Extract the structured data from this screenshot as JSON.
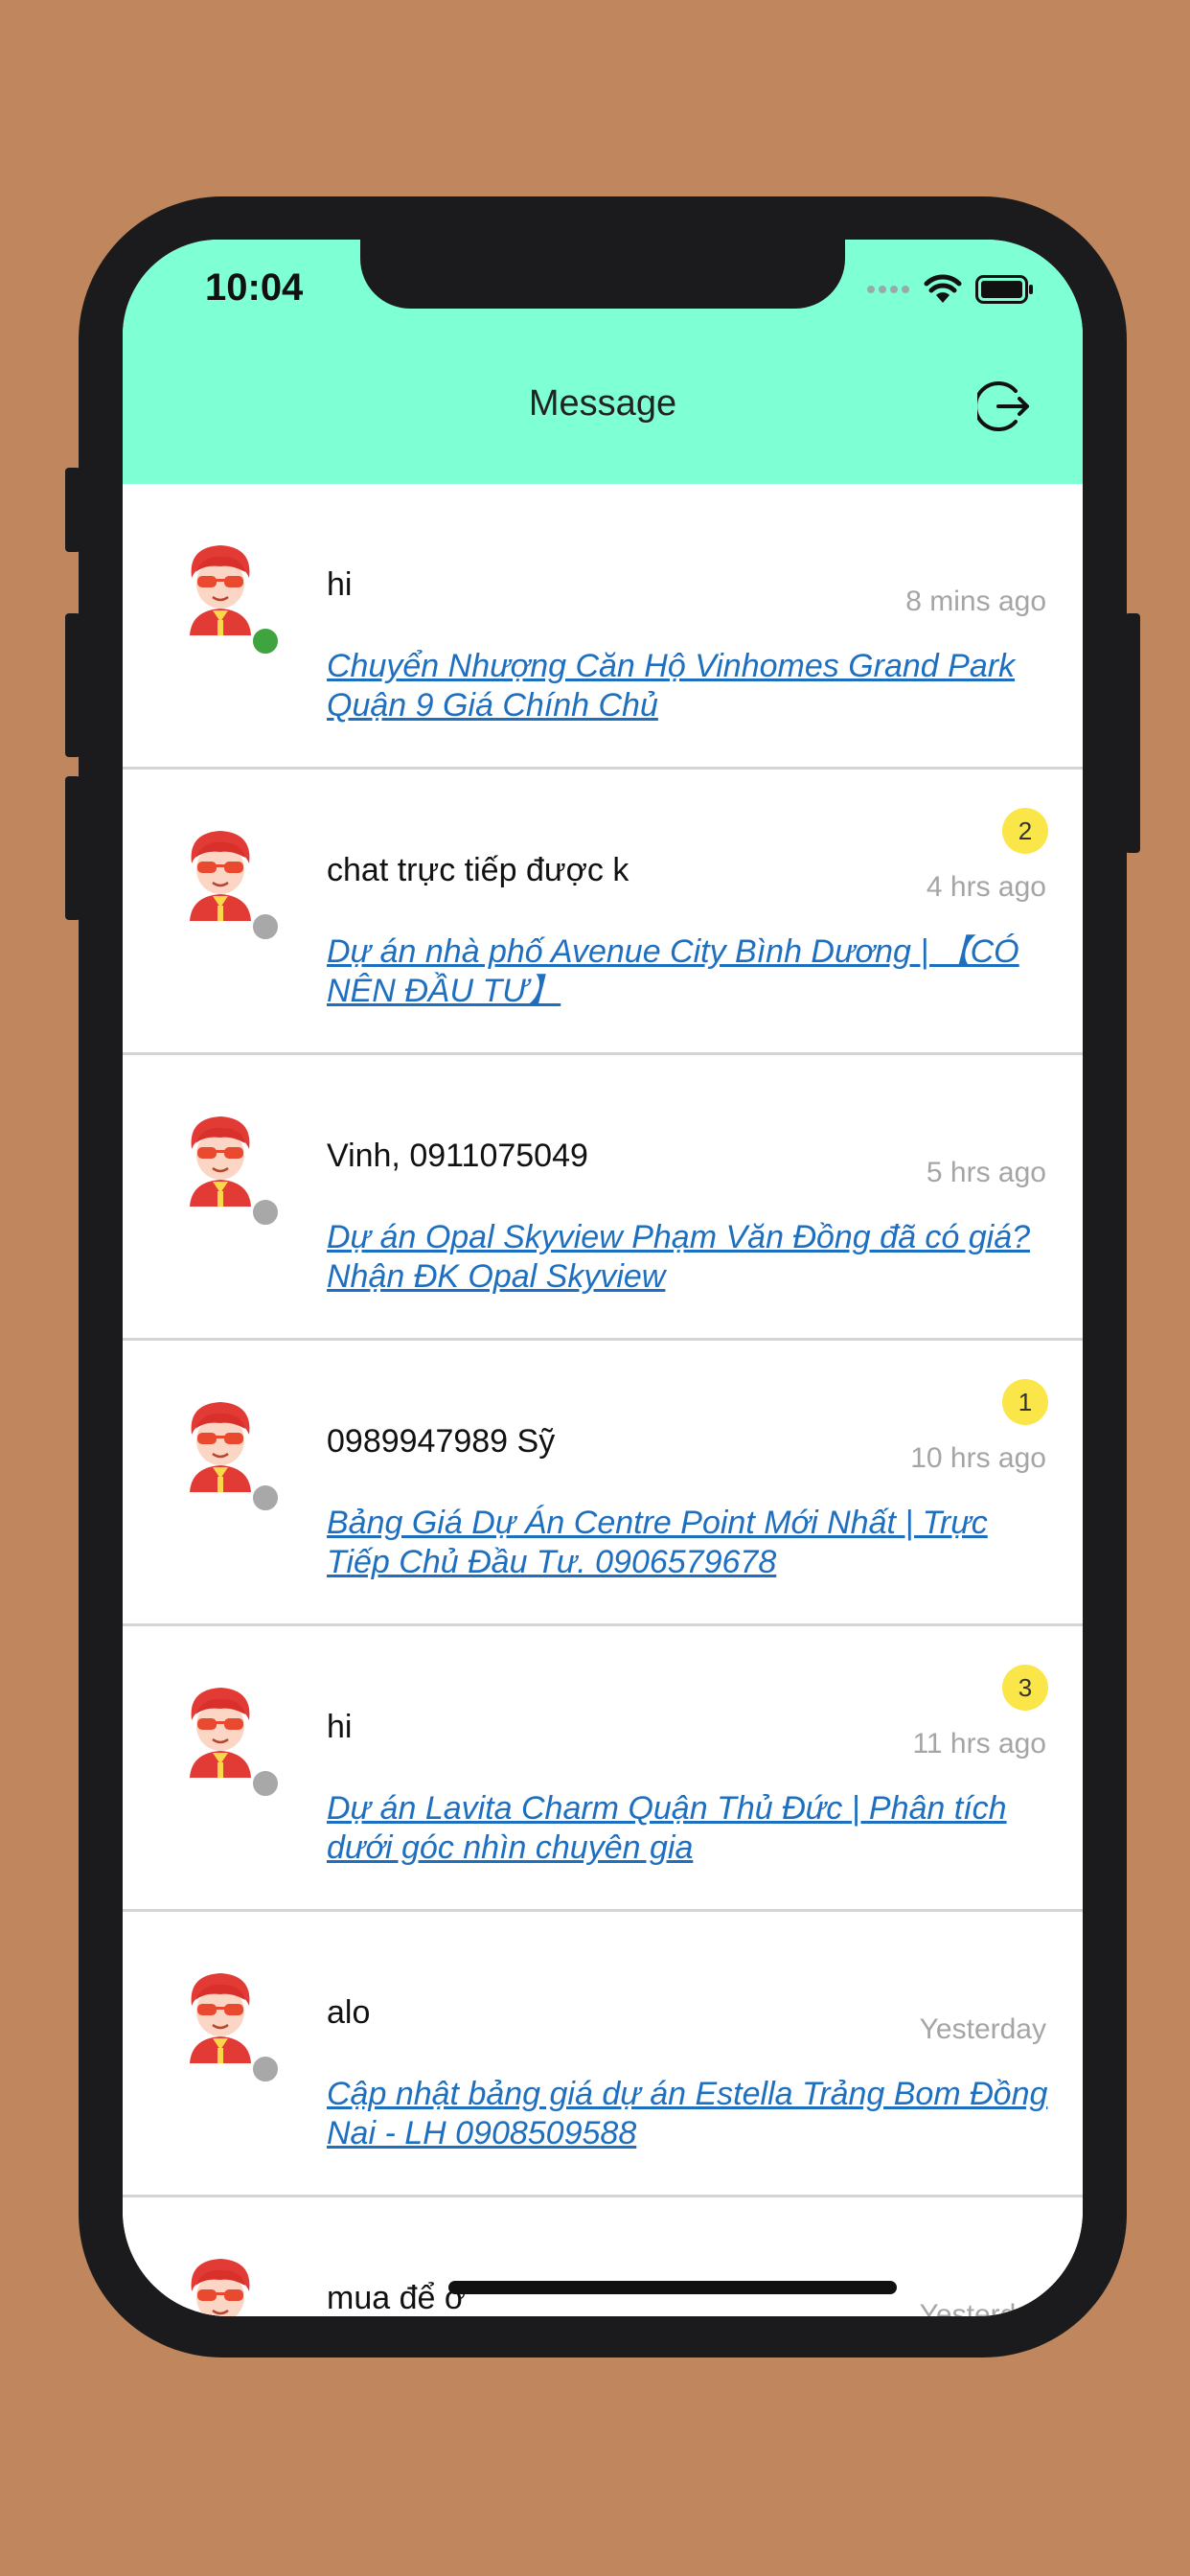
{
  "status_bar": {
    "time": "10:04"
  },
  "header": {
    "title": "Message",
    "logout_icon": "logout-icon"
  },
  "colors": {
    "background": "#c0875e",
    "header": "#7fffd4",
    "link": "#1e6fbf",
    "online": "#3fa33f",
    "offline": "#a8a8a8",
    "badge": "#fbe64a"
  },
  "conversations": [
    {
      "sender": "hi",
      "time": "8 mins ago",
      "topic": "Chuyển Nhượng Căn Hộ Vinhomes Grand Park Quận 9 Giá Chính Chủ",
      "online": true,
      "badge": ""
    },
    {
      "sender": "chat trực tiếp được k",
      "time": "4 hrs ago",
      "topic": "Dự án nhà phố Avenue City Bình Dương | 【CÓ NÊN ĐẦU TƯ】",
      "online": false,
      "badge": "2"
    },
    {
      "sender": "Vinh, 0911075049",
      "time": "5 hrs ago",
      "topic": "Dự án Opal Skyview Phạm Văn Đồng đã có giá? Nhận ĐK Opal Skyview",
      "online": false,
      "badge": ""
    },
    {
      "sender": "0989947989 Sỹ",
      "time": "10 hrs ago",
      "topic": "Bảng Giá Dự Án Centre Point Mới Nhất | Trực Tiếp Chủ Đầu Tư. 0906579678",
      "online": false,
      "badge": "1"
    },
    {
      "sender": "hi",
      "time": "11 hrs ago",
      "topic": "Dự án Lavita Charm Quận Thủ Đức | Phân tích dưới góc nhìn chuyên gia",
      "online": false,
      "badge": "3"
    },
    {
      "sender": "alo",
      "time": "Yesterday",
      "topic": "Cập nhật bảng giá dự án Estella Trảng Bom Đồng Nai - LH 0908509588",
      "online": false,
      "badge": ""
    },
    {
      "sender": "mua để ở",
      "time": "Yesterday",
      "topic": "",
      "online": false,
      "badge": ""
    }
  ]
}
